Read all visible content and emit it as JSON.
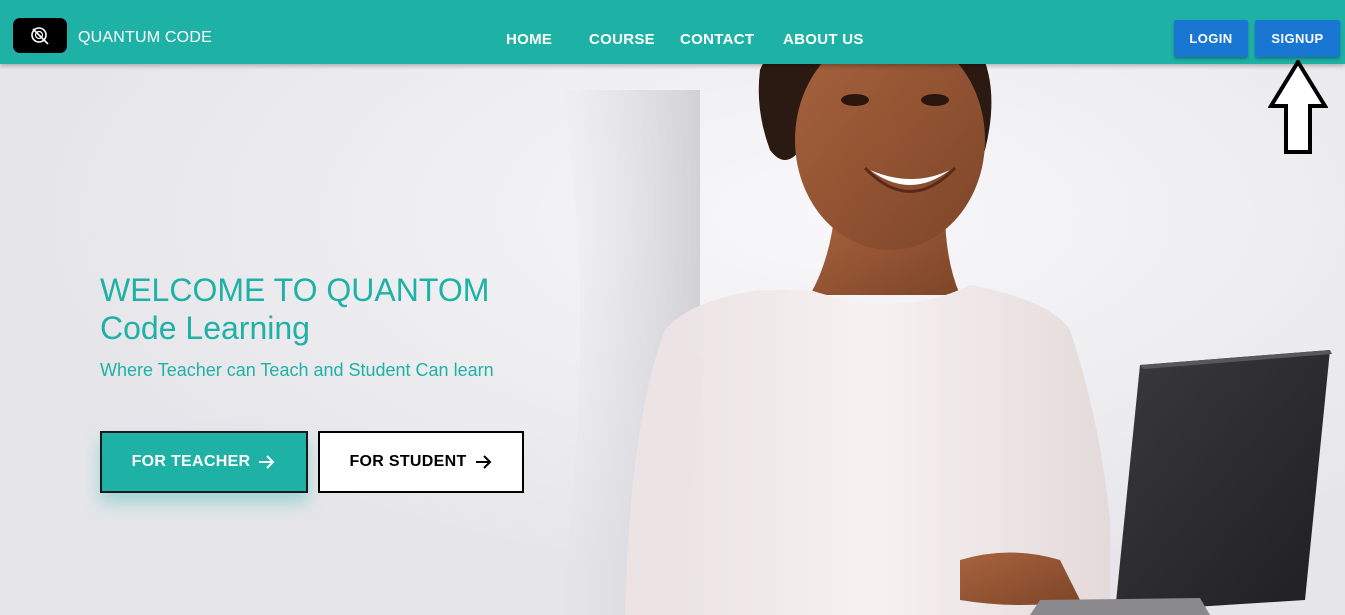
{
  "brand": {
    "name": "QUANTUM CODE",
    "logo_icon": "q-logo-icon"
  },
  "nav": {
    "links": [
      {
        "label": "HOME"
      },
      {
        "label": "COURSE"
      },
      {
        "label": "CONTACT"
      },
      {
        "label": "ABOUT US"
      }
    ]
  },
  "auth": {
    "login_label": "LOGIN",
    "signup_label": "SIGNUP"
  },
  "hero": {
    "title_line1": "WELCOME TO QUANTOM",
    "title_line2": "Code Learning",
    "subtitle": "Where Teacher can Teach and Student Can learn",
    "teacher_label": "FOR TEACHER",
    "student_label": "FOR STUDENT"
  },
  "colors": {
    "accent": "#1eb2a6",
    "button_blue": "#1976d2",
    "dark": "#000000"
  },
  "icons": {
    "annotation": "up-arrow-annotation-icon",
    "cta_arrow": "arrow-right-icon"
  }
}
